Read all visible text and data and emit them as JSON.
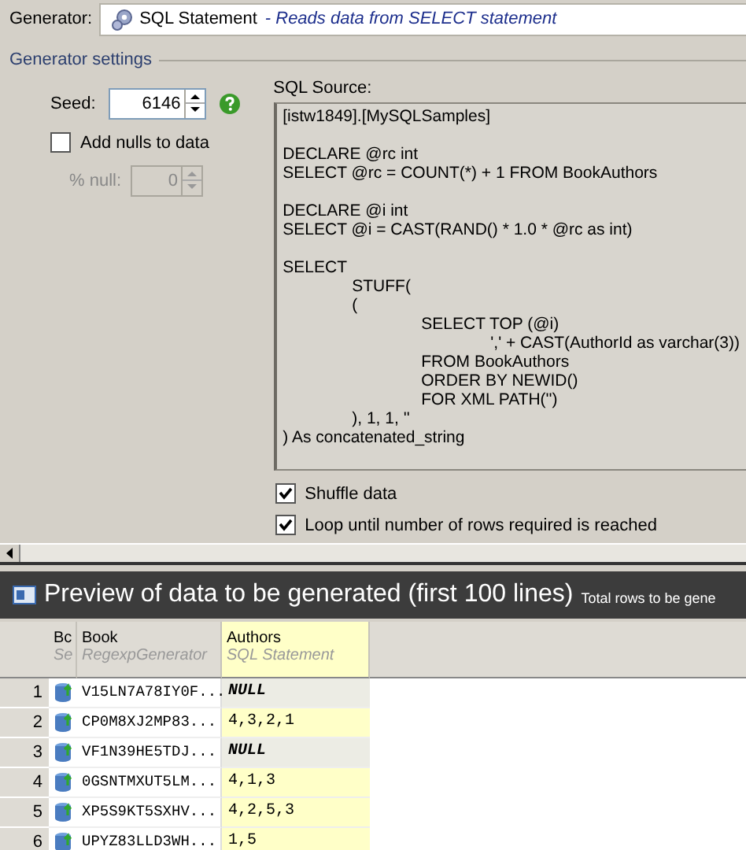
{
  "generator": {
    "label": "Generator:",
    "name": "SQL Statement",
    "description": "- Reads data from SELECT statement"
  },
  "settings": {
    "title": "Generator settings",
    "seed": {
      "label": "Seed:",
      "value": "6146"
    },
    "add_nulls": {
      "label": "Add nulls to data",
      "checked": false
    },
    "null_percent": {
      "label": "% null:",
      "value": "0",
      "disabled": true
    },
    "sql_source": {
      "label": "SQL Source:",
      "value": "[istw1849].[MySQLSamples]\n\nDECLARE @rc int\nSELECT @rc = COUNT(*) + 1 FROM BookAuthors\n\nDECLARE @i int\nSELECT @i = CAST(RAND() * 1.0 * @rc as int)\n\nSELECT\n\tSTUFF(\n\t(\n\t\tSELECT TOP (@i)\n\t\t\t',' + CAST(AuthorId as varchar(3))\n\t\tFROM BookAuthors\n\t\tORDER BY NEWID()\n\t\tFOR XML PATH('')\n\t), 1, 1, ''\n) As concatenated_string"
    },
    "options": [
      {
        "label": "Shuffle data",
        "checked": true
      },
      {
        "label": "Loop until number of rows required is reached",
        "checked": true
      }
    ]
  },
  "preview": {
    "title": "Preview of data to be generated (first 100 lines)",
    "subtitle": "Total rows to be gene",
    "columns": [
      {
        "name": "Bc",
        "generator": "Se",
        "selected": false
      },
      {
        "name": "Book",
        "generator": "RegexpGenerator",
        "selected": false
      },
      {
        "name": "Authors",
        "generator": "SQL Statement",
        "selected": true
      }
    ],
    "rows": [
      {
        "number": "1",
        "book": "V15LN7A78IY0F...",
        "authors": "NULL",
        "null": true
      },
      {
        "number": "2",
        "book": "CP0M8XJ2MP83...",
        "authors": "4,3,2,1",
        "null": false
      },
      {
        "number": "3",
        "book": "VF1N39HE5TDJ...",
        "authors": "NULL",
        "null": true
      },
      {
        "number": "4",
        "book": "0GSNTMXUT5LM...",
        "authors": "4,1,3",
        "null": false
      },
      {
        "number": "5",
        "book": "XP5S9KT5SXHV...",
        "authors": "4,2,5,3",
        "null": false
      },
      {
        "number": "6",
        "book": "UPYZ83LLD3WH...",
        "authors": "1,5",
        "null": false
      }
    ]
  }
}
